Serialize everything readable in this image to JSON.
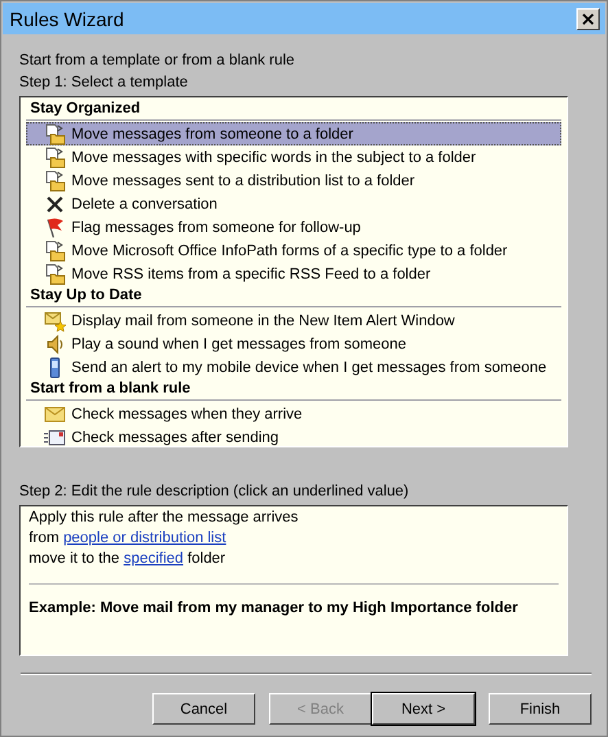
{
  "window": {
    "title": "Rules Wizard"
  },
  "intro": "Start from a template or from a blank rule",
  "step1_label": "Step 1: Select a template",
  "template_groups": [
    {
      "heading": "Stay Organized",
      "items": [
        {
          "label": "Move messages from someone to a folder",
          "kind": "move",
          "selected": true
        },
        {
          "label": "Move messages with specific words in the subject to a folder",
          "kind": "move",
          "selected": false
        },
        {
          "label": "Move messages sent to a distribution list to a folder",
          "kind": "move",
          "selected": false
        },
        {
          "label": "Delete a conversation",
          "kind": "delete",
          "selected": false
        },
        {
          "label": "Flag messages from someone for follow-up",
          "kind": "flag",
          "selected": false
        },
        {
          "label": "Move Microsoft Office InfoPath forms of a specific type to a folder",
          "kind": "move",
          "selected": false
        },
        {
          "label": "Move RSS items from a specific RSS Feed to a folder",
          "kind": "move",
          "selected": false
        }
      ]
    },
    {
      "heading": "Stay Up to Date",
      "items": [
        {
          "label": "Display mail from someone in the New Item Alert Window",
          "kind": "alert",
          "selected": false
        },
        {
          "label": "Play a sound when I get messages from someone",
          "kind": "sound",
          "selected": false
        },
        {
          "label": "Send an alert to my mobile device when I get messages from someone",
          "kind": "mobile",
          "selected": false
        }
      ]
    },
    {
      "heading": "Start from a blank rule",
      "items": [
        {
          "label": "Check messages when they arrive",
          "kind": "envelope",
          "selected": false
        },
        {
          "label": "Check messages after sending",
          "kind": "sent",
          "selected": false
        }
      ]
    }
  ],
  "step2_label": "Step 2: Edit the rule description (click an underlined value)",
  "description": {
    "lines": [
      {
        "parts": [
          {
            "text": "Apply this rule after the message arrives",
            "link": false
          }
        ]
      },
      {
        "parts": [
          {
            "text": "from ",
            "link": false
          },
          {
            "text": "people or distribution list",
            "link": true
          }
        ]
      },
      {
        "parts": [
          {
            "text": "move it to the ",
            "link": false
          },
          {
            "text": "specified",
            "link": true
          },
          {
            "text": " folder",
            "link": false
          }
        ]
      }
    ],
    "example": "Example: Move mail from my manager to my High Importance folder"
  },
  "buttons": [
    {
      "label": "Cancel",
      "disabled": false,
      "default": false
    },
    {
      "label": "< Back",
      "disabled": true,
      "default": false
    },
    {
      "label": "Next >",
      "disabled": false,
      "default": true
    },
    {
      "label": "Finish",
      "disabled": false,
      "default": false
    }
  ]
}
